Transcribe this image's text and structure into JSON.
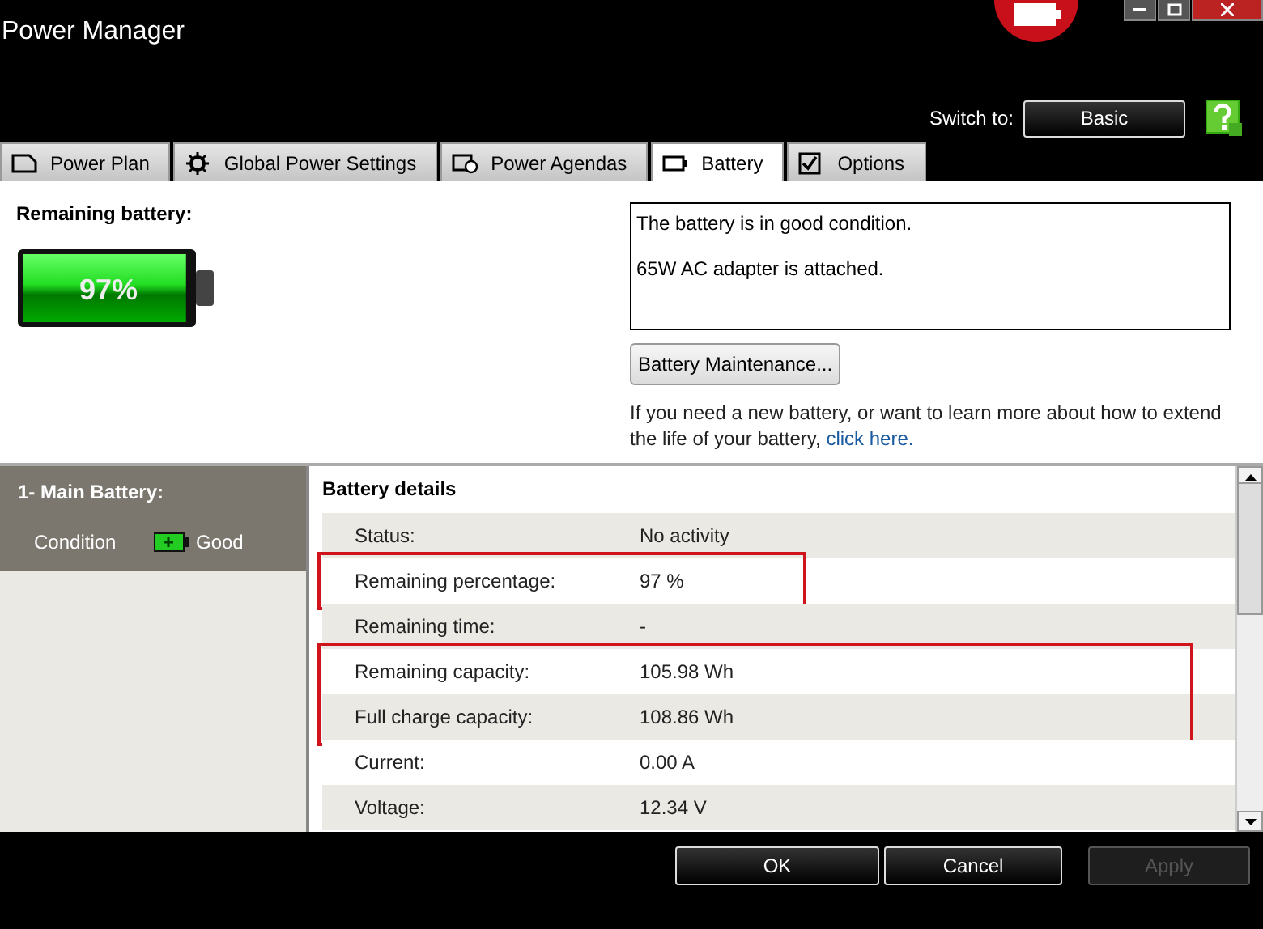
{
  "window": {
    "title": "Power Manager"
  },
  "switch_to": {
    "label": "Switch to:",
    "value": "Basic"
  },
  "tabs": [
    {
      "label": "Power Plan",
      "kind": "plan",
      "selected": false
    },
    {
      "label": "Global Power Settings",
      "kind": "settings",
      "selected": false
    },
    {
      "label": "Power Agendas",
      "kind": "agenda",
      "selected": false
    },
    {
      "label": "Battery",
      "kind": "battery",
      "selected": true
    },
    {
      "label": "Options",
      "kind": "options",
      "selected": false
    }
  ],
  "remaining": {
    "label": "Remaining battery:",
    "percent": "97%",
    "level": 0.97
  },
  "messages": [
    "The battery is in good condition.",
    "65W AC adapter is attached."
  ],
  "maintenance_button": "Battery Maintenance...",
  "info": {
    "text": "If you need a new battery, or want to learn more about how to extend the life of your battery,",
    "link": "click here."
  },
  "battery_list": [
    {
      "name": "1- Main Battery:",
      "condition_label": "Condition",
      "condition": "Good",
      "selected": true
    }
  ],
  "details": {
    "title": "Battery details",
    "groups": [
      {
        "highlighted": false,
        "rows": [
          {
            "label": "Status:",
            "value": "No activity"
          }
        ]
      },
      {
        "highlighted": true,
        "rows": [
          {
            "label": "Remaining percentage:",
            "value": "97 %"
          }
        ]
      },
      {
        "highlighted": false,
        "rows": [
          {
            "label": "Remaining time:",
            "value": "-"
          }
        ]
      },
      {
        "highlighted": true,
        "rows": [
          {
            "label": "Remaining capacity:",
            "value": "105.98 Wh"
          },
          {
            "label": "Full charge capacity:",
            "value": "108.86 Wh"
          }
        ]
      },
      {
        "highlighted": false,
        "rows": [
          {
            "label": "Current:",
            "value": "0.00 A"
          },
          {
            "label": "Voltage:",
            "value": "12.34 V"
          }
        ]
      }
    ]
  },
  "buttons": [
    {
      "label": "OK",
      "disabled": false
    },
    {
      "label": "Cancel",
      "disabled": false
    },
    {
      "label": "Apply",
      "disabled": true
    }
  ]
}
